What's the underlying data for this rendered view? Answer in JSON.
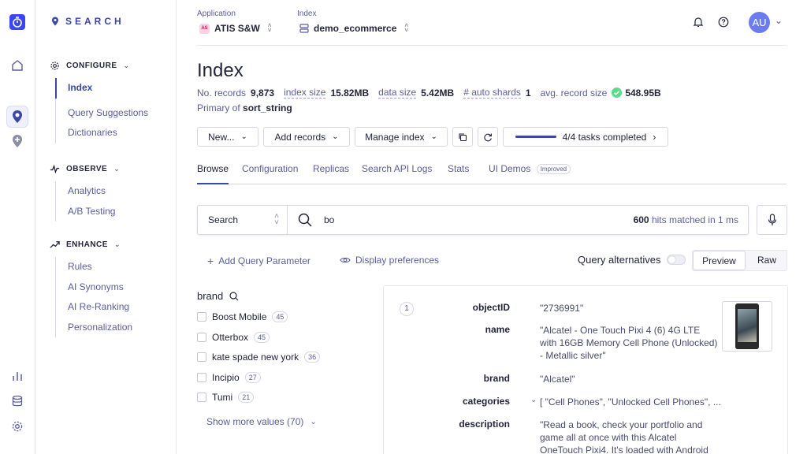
{
  "sidebar": {
    "logo_text": "SEARCH",
    "sections": [
      {
        "title": "CONFIGURE",
        "items": [
          "Index",
          "Query Suggestions",
          "Dictionaries"
        ]
      },
      {
        "title": "OBSERVE",
        "items": [
          "Analytics",
          "A/B Testing"
        ]
      },
      {
        "title": "ENHANCE",
        "items": [
          "Rules",
          "AI Synonyms",
          "AI Re-Ranking",
          "Personalization"
        ]
      }
    ]
  },
  "topbar": {
    "application_label": "Application",
    "application_value": "ATIS S&W",
    "application_badge": "AS",
    "index_label": "Index",
    "index_value": "demo_ecommerce",
    "avatar_initials": "AU"
  },
  "page": {
    "title": "Index",
    "stats": [
      {
        "label": "No. records",
        "value": "9,873"
      },
      {
        "label": "index size",
        "value": "15.82MB"
      },
      {
        "label": "data size",
        "value": "5.42MB"
      },
      {
        "label": "# auto shards",
        "value": "1"
      },
      {
        "label": "avg. record size",
        "value": "548.95B"
      }
    ],
    "primary_prefix": "Primary of",
    "primary_value": "sort_string"
  },
  "toolbar": {
    "new_label": "New...",
    "add_records_label": "Add records",
    "manage_index_label": "Manage index",
    "tasks_label": "4/4 tasks completed",
    "tasks_progress": 1.0
  },
  "tabs": [
    "Browse",
    "Configuration",
    "Replicas",
    "Search API Logs",
    "Stats",
    "UI Demos"
  ],
  "tab_badge": "Improved",
  "search": {
    "type": "Search",
    "query": "bo",
    "hits_count": "600",
    "hits_text": "hits matched in 1 ms"
  },
  "tools": {
    "add_param": "Add Query Parameter",
    "display_prefs": "Display preferences",
    "query_alternatives": "Query alternatives",
    "preview": "Preview",
    "raw": "Raw"
  },
  "facets": {
    "title": "brand",
    "items": [
      {
        "label": "Boost Mobile",
        "count": "45"
      },
      {
        "label": "Otterbox",
        "count": "45"
      },
      {
        "label": "kate spade new york",
        "count": "36"
      },
      {
        "label": "Incipio",
        "count": "27"
      },
      {
        "label": "Tumi",
        "count": "21"
      }
    ],
    "show_more": "Show more values (70)"
  },
  "record": {
    "index": "1",
    "fields": [
      {
        "key": "objectID",
        "value": "\"2736991\""
      },
      {
        "key": "name",
        "value": "\"Alcatel - One Touch Pixi 4 (6) 4G LTE with 16GB Memory Cell Phone (Unlocked) - Metallic silver\""
      },
      {
        "key": "brand",
        "value": "\"Alcatel\""
      },
      {
        "key": "categories",
        "value": "[ \"Cell Phones\", \"Unlocked Cell Phones\", ..."
      },
      {
        "key": "description",
        "value": "\"Read a book, check your portfolio and game all at once with this Alcatel OneTouch Pixi4. It's loaded with Android M, which"
      }
    ]
  }
}
